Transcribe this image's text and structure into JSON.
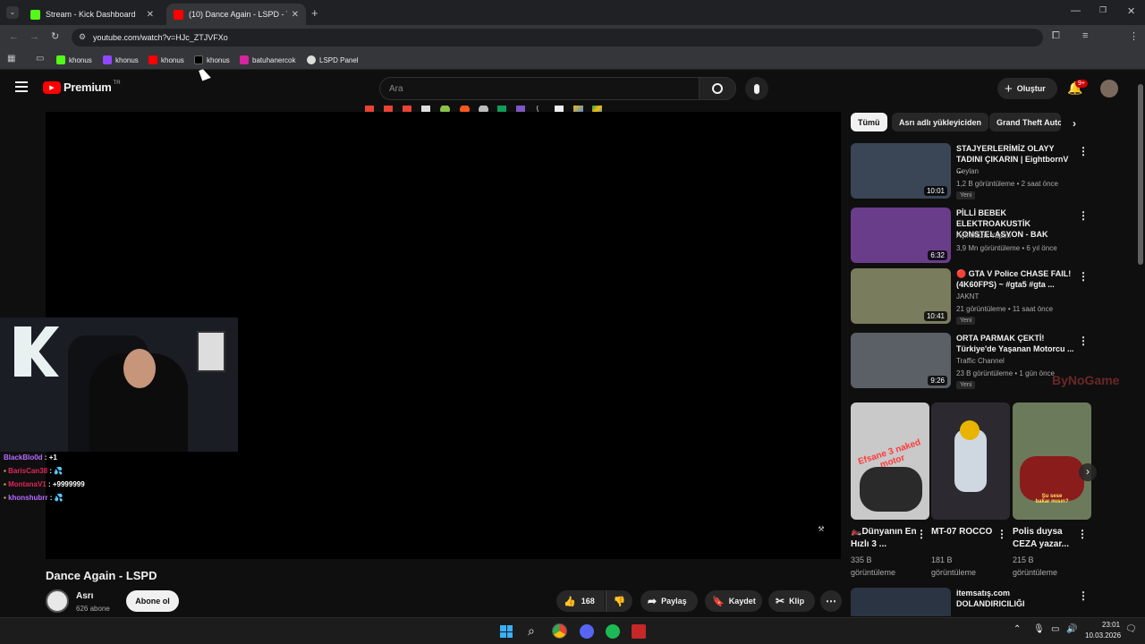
{
  "browser": {
    "tabs": [
      {
        "title": "Stream - Kick Dashboard",
        "active": false
      },
      {
        "title": "(10) Dance Again - LSPD - YouT",
        "active": true
      }
    ],
    "url": "youtube.com/watch?v=HJc_ZTJVFXo",
    "bookmarks": [
      {
        "label": "khonus",
        "icon": "kick-icon"
      },
      {
        "label": "khonus",
        "icon": "twitch-icon"
      },
      {
        "label": "khonus",
        "icon": "youtube-icon"
      },
      {
        "label": "khonus",
        "icon": "x-icon"
      },
      {
        "label": "batuhanercok",
        "icon": "instagram-icon"
      },
      {
        "label": "LSPD Panel",
        "icon": "lspd-icon"
      }
    ]
  },
  "header": {
    "logo": "Premium",
    "country": "TR",
    "search_placeholder": "Ara",
    "create_label": "Oluştur",
    "notif_count": "9+"
  },
  "chips": [
    "Tümü",
    "Asrı adlı yükleyiciden",
    "Grand Theft Auto"
  ],
  "video": {
    "title": "Dance Again - LSPD",
    "channel": "Asrı",
    "subscribers": "626 abone",
    "subscribe_label": "Abone ol",
    "likes": "168",
    "share_label": "Paylaş",
    "save_label": "Kaydet",
    "clip_label": "Klip"
  },
  "overlay": {
    "chat": [
      {
        "user": "BlackBlo0d",
        "msg": "+1",
        "color": "#b56cff"
      },
      {
        "user": "BarisCan38",
        "msg": "💦",
        "color": "#e0245e"
      },
      {
        "user": "MontanaV1",
        "msg": "+9999999",
        "color": "#e0245e"
      },
      {
        "user": "khonshubrr",
        "msg": "💦",
        "color": "#b56cff"
      }
    ],
    "watermark": "ByNoGame"
  },
  "recommendations": [
    {
      "title": "STAJYERLERİMİZ OLAYY TADINI ÇIKARIN | EightbornV ...",
      "channel": "Ceylan",
      "meta": "1,2 B görüntüleme • 2 saat önce",
      "badge": "Yeni",
      "duration": "10:01",
      "thumb_color": "#3a4656"
    },
    {
      "title": "PİLLİ BEBEK ELEKTROAKUSTİK KONSTELASYON - BAK",
      "channel": "Aşk Müzik Yapım",
      "meta": "3,9 Mn görüntüleme • 6 yıl önce",
      "badge": "",
      "duration": "6:32",
      "thumb_color": "#6a3d8a"
    },
    {
      "title": "🔴 GTA V Police CHASE FAIL! (4K60FPS) ~ #gta5 #gta ...",
      "channel": "JAKNT",
      "meta": "21 görüntüleme • 11 saat önce",
      "badge": "Yeni",
      "duration": "10:41",
      "thumb_color": "#7a7c5e"
    },
    {
      "title": "ORTA PARMAK ÇEKTİ! Türkiye'de Yaşanan Motorcu ...",
      "channel": "Traffic Channel",
      "meta": "23 B görüntüleme • 1 gün önce",
      "badge": "Yeni",
      "duration": "9:26",
      "thumb_color": "#5b5f66"
    },
    {
      "title": "itemsatış.com DOLANDIRICILIĞI",
      "channel": "",
      "meta": "",
      "badge": "",
      "duration": "",
      "thumb_color": "#2a3442"
    }
  ],
  "shorts": [
    {
      "title": "🏍️Dünyanın En Hızlı 3 ...",
      "views": "335 B görüntüleme",
      "caption": "Efsane 3 naked motor",
      "thumb_color": "#c9c9c9"
    },
    {
      "title": "MT-07 ROCCO",
      "views": "181 B görüntüleme",
      "caption": "",
      "thumb_color": "#2c2a30"
    },
    {
      "title": "Polis duysa CEZA yazar...",
      "views": "215 B görüntüleme",
      "caption": "Şu sese bakar mısın?",
      "thumb_color": "#6b7a5a"
    }
  ],
  "taskbar": {
    "time": "23:01",
    "date": "10.03.2026"
  }
}
